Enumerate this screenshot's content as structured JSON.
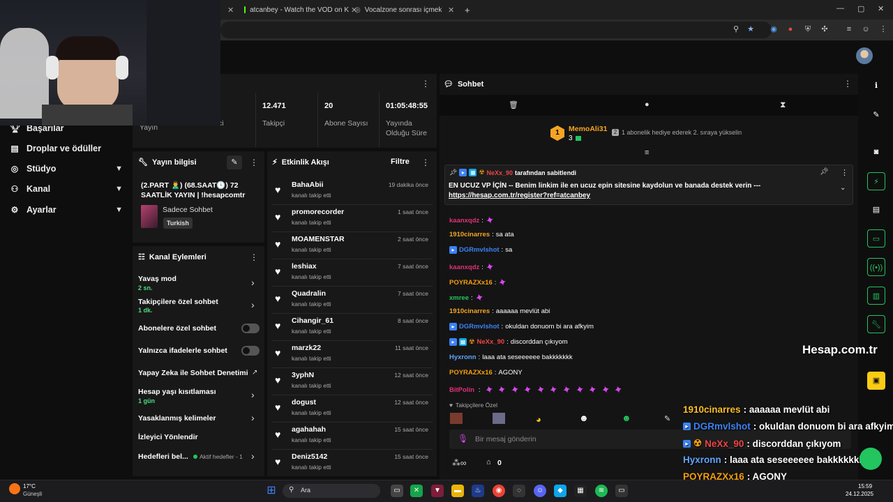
{
  "browser": {
    "tabs": [
      {
        "label": "atcanbey - Watch the VOD on K"
      },
      {
        "label": "Vocalzone sonrası içmek"
      }
    ],
    "new_tab_symbol": "+"
  },
  "sidebar": {
    "items": [
      {
        "label": "Başarılar",
        "icon": "trophy-icon"
      },
      {
        "label": "Droplar ve ödüller",
        "icon": "gift-icon"
      },
      {
        "label": "Stüdyo",
        "icon": "studio-icon"
      },
      {
        "label": "Kanal",
        "icon": "users-icon"
      },
      {
        "label": "Ayarlar",
        "icon": "gear-icon"
      }
    ],
    "partial_labels": {
      "yayin": "Yayın",
      "ci": "ci"
    }
  },
  "stats": [
    {
      "value": "12.471",
      "label": "Takipçi"
    },
    {
      "value": "20",
      "label": "Abone Sayısı"
    },
    {
      "value": "01:05:48:55",
      "label": "Yayında Olduğu Süre"
    }
  ],
  "stream_info": {
    "header": "Yayın bilgisi",
    "title": "(2.PART 🙎‍♂️) (68.SAAT🕓) 72 SAATLİK YAYIN | !hesapcomtr",
    "category": "Sadece Sohbet",
    "tag": "Turkish"
  },
  "channel_actions": {
    "header": "Kanal Eylemleri",
    "items": [
      {
        "label": "Yavaş mod",
        "sub": "2 sn."
      },
      {
        "label": "Takipçilere özel sohbet",
        "sub": "1 dk."
      },
      {
        "label": "Abonelere özel sohbet"
      },
      {
        "label": "Yalnızca ifadelerle sohbet"
      },
      {
        "label": "Yapay Zeka ile Sohbet Denetimi"
      },
      {
        "label": "Hesap yaşı kısıtlaması",
        "sub": "1 gün"
      },
      {
        "label": "Yasaklanmış kelimeler"
      },
      {
        "label": "İzleyici Yönlendir"
      },
      {
        "label": "Hedefleri bel...",
        "sub": "Aktif hedefler - 1"
      }
    ]
  },
  "activity": {
    "header": "Etkinlik Akışı",
    "filter": "Filtre",
    "events": [
      {
        "name": "BahaAbii",
        "action": "kanalı takip etti",
        "time": "19 dakika önce"
      },
      {
        "name": "promorecorder",
        "action": "kanalı takip etti",
        "time": "1 saat önce"
      },
      {
        "name": "MOAMENSTAR",
        "action": "kanalı takip etti",
        "time": "2 saat önce"
      },
      {
        "name": "leshiax",
        "action": "kanalı takip etti",
        "time": "7 saat önce"
      },
      {
        "name": "Quadralin",
        "action": "kanalı takip etti",
        "time": "7 saat önce"
      },
      {
        "name": "Cihangir_61",
        "action": "kanalı takip etti",
        "time": "8 saat önce"
      },
      {
        "name": "marzk22",
        "action": "kanalı takip etti",
        "time": "11 saat önce"
      },
      {
        "name": "3yphN",
        "action": "kanalı takip etti",
        "time": "12 saat önce"
      },
      {
        "name": "dogust",
        "action": "kanalı takip etti",
        "time": "12 saat önce"
      },
      {
        "name": "agahahah",
        "action": "kanalı takip etti",
        "time": "15 saat önce"
      },
      {
        "name": "Deniz5142",
        "action": "kanalı takip etti",
        "time": "15 saat önce"
      }
    ]
  },
  "chat": {
    "header": "Sohbet",
    "leader": {
      "rank": "1",
      "name": "MemoAli31",
      "count": "3",
      "note": "1 abonelik hediye ederek 2. sıraya yükselin",
      "note_badge": "2"
    },
    "pinned": {
      "user": "NeXx_90",
      "by_text": "tarafından sabitlendi",
      "message": "EN UCUZ VP İÇİN -- Benim linkim ile en ucuz epin sitesine kaydolun ve banada destek verin ---",
      "link": "https://hesap.com.tr/register?ref=atcanbey"
    },
    "messages": [
      {
        "user": "kaanxqdz",
        "color": "#e0307a",
        "text": "",
        "emotes": 1
      },
      {
        "user": "1910cinarres",
        "color": "#f5a524",
        "text": "sa ata",
        "emotes": 0
      },
      {
        "user": "DGRmvlshot",
        "color": "#3b82f6",
        "text": "sa",
        "emotes": 0,
        "badge": true
      },
      {
        "user": "kaanxqdz",
        "color": "#e0307a",
        "text": "",
        "emotes": 1
      },
      {
        "user": "POYRAZXx16",
        "color": "#f59e0b",
        "text": "",
        "emotes": 1
      },
      {
        "user": "xmree",
        "color": "#22c55e",
        "text": "",
        "emotes": 1
      },
      {
        "user": "1910cinarres",
        "color": "#f5a524",
        "text": "aaaaaa mevlüt abi",
        "emotes": 0
      },
      {
        "user": "DGRmvlshot",
        "color": "#3b82f6",
        "text": "okuldan donuom bi ara afkyim",
        "emotes": 0,
        "badge": true
      },
      {
        "user": "NeXx_90",
        "color": "#ef4444",
        "text": "discorddan çıkıyom",
        "emotes": 0,
        "badge": true
      },
      {
        "user": "Hyxronn",
        "color": "#60a5fa",
        "text": "laaa ata seseeeeee bakkkkkkk",
        "emotes": 0
      },
      {
        "user": "POYRAZXx16",
        "color": "#f59e0b",
        "text": "AGONY",
        "emotes": 0
      },
      {
        "user": "BitPolin",
        "color": "#e0307a",
        "text": "",
        "emotes": 11
      }
    ],
    "follower_only": "Takipçilere Özel",
    "input_placeholder": "Bir mesaj gönderin",
    "viewers": "0"
  },
  "overlay": {
    "brand": "Hesap.com.tr",
    "lines": [
      {
        "user": "1910cinarres",
        "text": ": aaaaaa mevlüt abi",
        "color": "#fbbf24"
      },
      {
        "user": "DGRmvlshot",
        "text": ": okuldan donuom bi ara afkyim",
        "color": "#3b82f6"
      },
      {
        "user": "NeXx_90",
        "text": ": discorddan çıkıyom",
        "color": "#ef4444"
      },
      {
        "user": "Hyxronn",
        "text": ": laaa ata seseeeeee bakkkkkkk",
        "color": "#60a5fa"
      },
      {
        "user": "POYRAZXx16",
        "text": ": AGONY",
        "color": "#f59e0b"
      },
      {
        "user": "BitPolin",
        "text": ":",
        "color": "#e0307a"
      }
    ]
  },
  "taskbar": {
    "weather_temp": "17°C",
    "weather_desc": "Güneşli",
    "search": "Ara",
    "time": "15:59",
    "date": "24.12.2025"
  }
}
